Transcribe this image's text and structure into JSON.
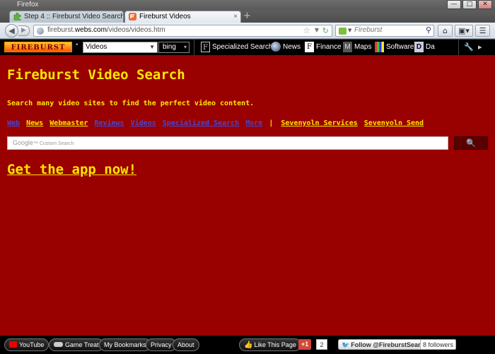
{
  "window": {
    "app_title": "Firefox",
    "controls": {
      "minimize": "—",
      "maximize": "□",
      "close": "✕"
    }
  },
  "tabs": [
    {
      "title": "Step 4 :: Fireburst Video Search :...",
      "active": false
    },
    {
      "title": "Fireburst Videos",
      "active": true
    }
  ],
  "tab_close": "×",
  "new_tab": "+",
  "navbar": {
    "back": "◀",
    "forward": "▶",
    "url_prefix": "fireburst.",
    "url_domain": "webs.com",
    "url_path": "/videos/videos.htm",
    "star": "☆",
    "dropdown": "▼",
    "reload": "↻",
    "search_engine_caret": "▼",
    "search_placeholder": "Fireburst",
    "magnifier": "⚲",
    "home": "⌂",
    "addon": "▣▾",
    "menu": "☰"
  },
  "fireburst_toolbar": {
    "logo_text": "FIREBURST",
    "dot": "•",
    "search_type": "Videos",
    "select_caret": "▼",
    "engine": "bing",
    "engine_caret": "▾",
    "links": [
      {
        "label": "Specialized Search",
        "icon": "F"
      },
      {
        "label": "News",
        "icon": ""
      },
      {
        "label": "Finance",
        "icon": "F"
      },
      {
        "label": "Maps",
        "icon": "M"
      },
      {
        "label": "Software",
        "icon": ""
      },
      {
        "label": "Da",
        "icon": "D"
      }
    ],
    "wrench": "🔧",
    "scroll": "▸"
  },
  "page": {
    "title": "Fireburst Video Search",
    "description": "Search many video sites to find the perfect video content.",
    "nav_links": [
      {
        "label": "Web",
        "style": "blue"
      },
      {
        "label": "News",
        "style": "yellow"
      },
      {
        "label": "Webmaster",
        "style": "yellow"
      },
      {
        "label": "Reviews",
        "style": "blue"
      },
      {
        "label": "Videos",
        "style": "blue"
      },
      {
        "label": "Specialized Search",
        "style": "blue"
      },
      {
        "label": "More",
        "style": "blue"
      }
    ],
    "nav_separator": "|",
    "nav_extra_links": [
      "Sevenyoln Services",
      "Sevenyoln Send"
    ],
    "search_hint_brand": "Google",
    "search_hint_tm": "™",
    "search_hint_text": " Custom Search",
    "search_button_icon": "🔍",
    "app_link": "Get the app now!"
  },
  "bottombar": {
    "youtube": "YouTube",
    "game_treat": "Game Treat",
    "bookmarks": "My Bookmarks",
    "privacy": "Privacy",
    "about": "About",
    "like": "Like This Page",
    "like_icon": "👍",
    "gplus": "+1",
    "gplus_count": "2",
    "twitter_icon": "🐦",
    "twitter": "Follow @FireburstSearch",
    "followers": "8 followers"
  }
}
